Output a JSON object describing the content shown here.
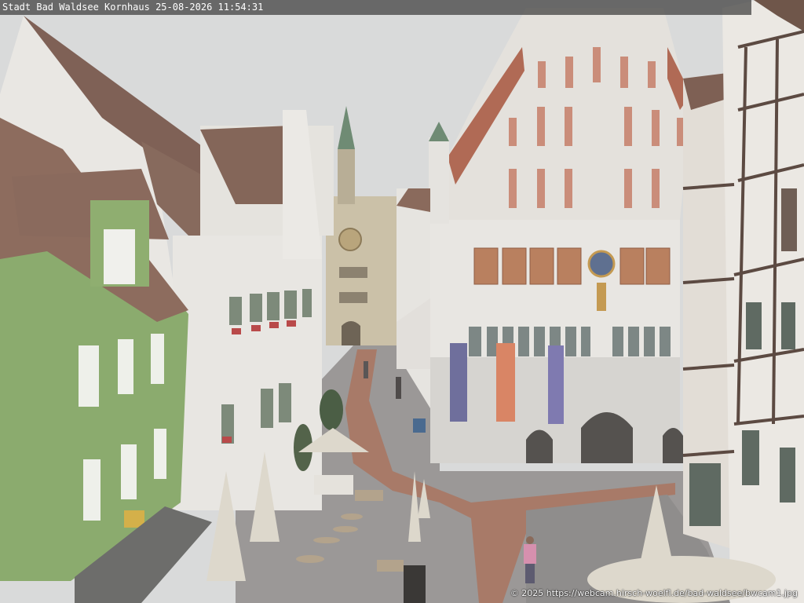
{
  "overlay": {
    "title": "Stadt Bad Waldsee Kornhaus 25-08-2026 11:54:31",
    "credit": "© 2025 https://webcam.hirsch-woelfl.de/bad-waldsee/bwcam1.jpg"
  },
  "colors": {
    "sky": "#d9dada",
    "green_house": "#8bab6e",
    "roof": "#8a6a5a",
    "stone": "#e4e1dc",
    "brick_path": "#a87a68",
    "cobble": "#9b9897",
    "flag_blue": "#6f6f9c",
    "flag_orange": "#d98565",
    "flag_violet": "#7f7ab0"
  }
}
